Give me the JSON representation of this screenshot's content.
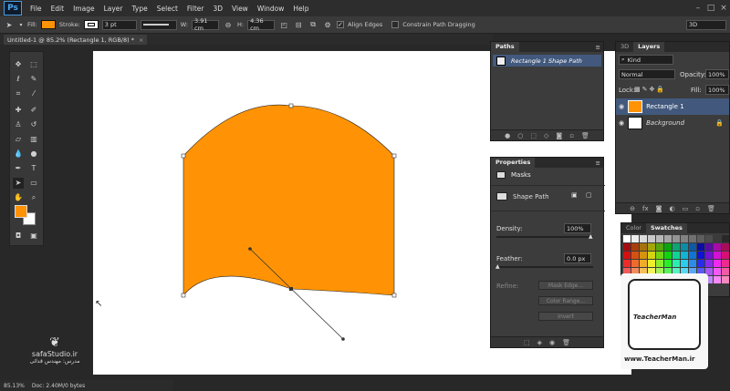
{
  "menubar": {
    "logo": "Ps",
    "items": [
      "File",
      "Edit",
      "Image",
      "Layer",
      "Type",
      "Select",
      "Filter",
      "3D",
      "View",
      "Window",
      "Help"
    ],
    "window_controls": [
      "–",
      "□",
      "×"
    ]
  },
  "options": {
    "fill_label": "Fill:",
    "fill_color": "#ff9305",
    "stroke_label": "Stroke:",
    "stroke_size": "3 pt",
    "w_label": "W:",
    "w_value": "3.91 cm",
    "h_label": "H:",
    "h_value": "4.36 cm",
    "align_edges": "Align Edges",
    "constrain": "Constrain Path Dragging",
    "workspace": "3D"
  },
  "document": {
    "tab_title": "Untitled-1 @ 85.2% (Rectangle 1, RGB/8) *",
    "shape_color": "#ff9305"
  },
  "status": {
    "zoom": "85.13%",
    "doc": "Doc: 2.40M/0 bytes"
  },
  "paths_panel": {
    "tab": "Paths",
    "item": "Rectangle 1 Shape Path"
  },
  "properties_panel": {
    "tab": "Properties",
    "section": "Masks",
    "mask_type": "Shape Path",
    "density_label": "Density:",
    "density_value": "100%",
    "feather_label": "Feather:",
    "feather_value": "0.0 px",
    "refine_label": "Refine:",
    "mask_edge": "Mask Edge...",
    "color_range": "Color Range...",
    "invert": "Invert"
  },
  "layers_panel": {
    "tab_3d": "3D",
    "tab_layers": "Layers",
    "kind": "Kind",
    "blend_mode": "Normal",
    "opacity_label": "Opacity:",
    "opacity_value": "100%",
    "lock_label": "Lock:",
    "fill_label": "Fill:",
    "fill_value": "100%",
    "layers": [
      {
        "name": "Rectangle 1"
      },
      {
        "name": "Background"
      }
    ]
  },
  "swatches_panel": {
    "tab_color": "Color",
    "tab_swatches": "Swatches"
  },
  "watermark": {
    "left_brand": "safaStudio.ir",
    "left_sub": "مدرس: مهندس قدائی",
    "right_brand": "TeacherMan",
    "right_url": "www.TeacherMan.ir"
  },
  "colors": {
    "accent": "#ff9305",
    "panel_bg": "#3c3c3c",
    "selection": "#42597d"
  }
}
